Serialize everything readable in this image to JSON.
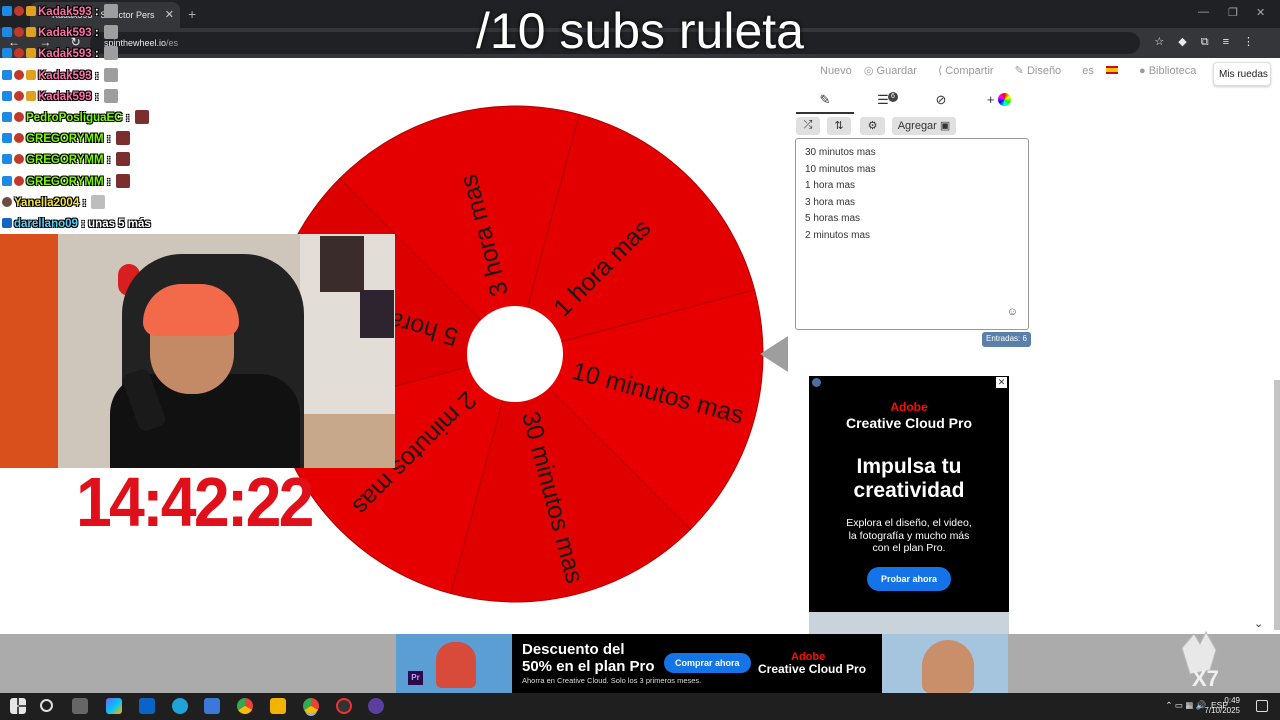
{
  "browser": {
    "tab_title": "Kadak593 - Selector Pers",
    "url_host": "spinthewheel.io",
    "url_path": "/es"
  },
  "overlay": {
    "title": "/10 subs ruleta"
  },
  "site_header": {
    "nuevo": "Nuevo",
    "guardar": "Guardar",
    "compartir": "Compartir",
    "diseno": "Diseño",
    "lang": "es",
    "biblioteca": "Biblioteca",
    "mis_ruedas": "Mis ruedas"
  },
  "wheel": {
    "segments": [
      "10 minutos mas",
      "30 minutos mas",
      "2 minutos mas",
      "5 horas mas",
      "3 hora mas",
      "1 hora mas"
    ],
    "color": "#e50000"
  },
  "editor": {
    "add_label": "Agregar",
    "tab_badge": "6",
    "entries": [
      "30 minutos mas",
      "10 minutos mas",
      "1 hora mas",
      "3 hora mas",
      "5 horas mas",
      "2 minutos mas"
    ],
    "count_label": "Entradas: 6"
  },
  "ad_right": {
    "brand": "Adobe",
    "product": "Creative Cloud Pro",
    "headline_1": "Impulsa tu",
    "headline_2": "creatividad",
    "body_1": "Explora el diseño, el video,",
    "body_2": "la fotografía y mucho más",
    "body_3": "con el plan Pro.",
    "cta": "Probar ahora"
  },
  "ad_bottom": {
    "headline_1": "Descuento del",
    "headline_2": "50% en el plan Pro",
    "sub": "Ahorra en Creative Cloud. Solo los 3 primeros meses.",
    "cta": "Comprar ahora",
    "brand": "Adobe",
    "product": "Creative Cloud Pro",
    "badge": "Pr"
  },
  "chat": [
    {
      "user": "Kadak593",
      "msg": ":",
      "color": "pink"
    },
    {
      "user": "Kadak593",
      "msg": ":",
      "color": "pink"
    },
    {
      "user": "Kadak593",
      "msg": ":",
      "color": "pink"
    },
    {
      "user": "Kadak593",
      "msg": ":",
      "color": "pink"
    },
    {
      "user": "Kadak593",
      "msg": ":",
      "color": "pink"
    },
    {
      "user": "PedroPosliguaEC",
      "msg": ":",
      "color": "green"
    },
    {
      "user": "GREGORYMM",
      "msg": ":",
      "color": "green"
    },
    {
      "user": "GREGORYMM",
      "msg": ":",
      "color": "green"
    },
    {
      "user": "GREGORYMM",
      "msg": ":",
      "color": "green"
    },
    {
      "user": "Yanella2004",
      "msg": ":",
      "color": "yellow"
    },
    {
      "user": "darellano09",
      "msg": ": unas 5 más",
      "color": "cyan"
    }
  ],
  "timer": "14:42:22",
  "taskbar": {
    "lang": "ESP",
    "time": "0:49",
    "date": "7/10/2025"
  }
}
